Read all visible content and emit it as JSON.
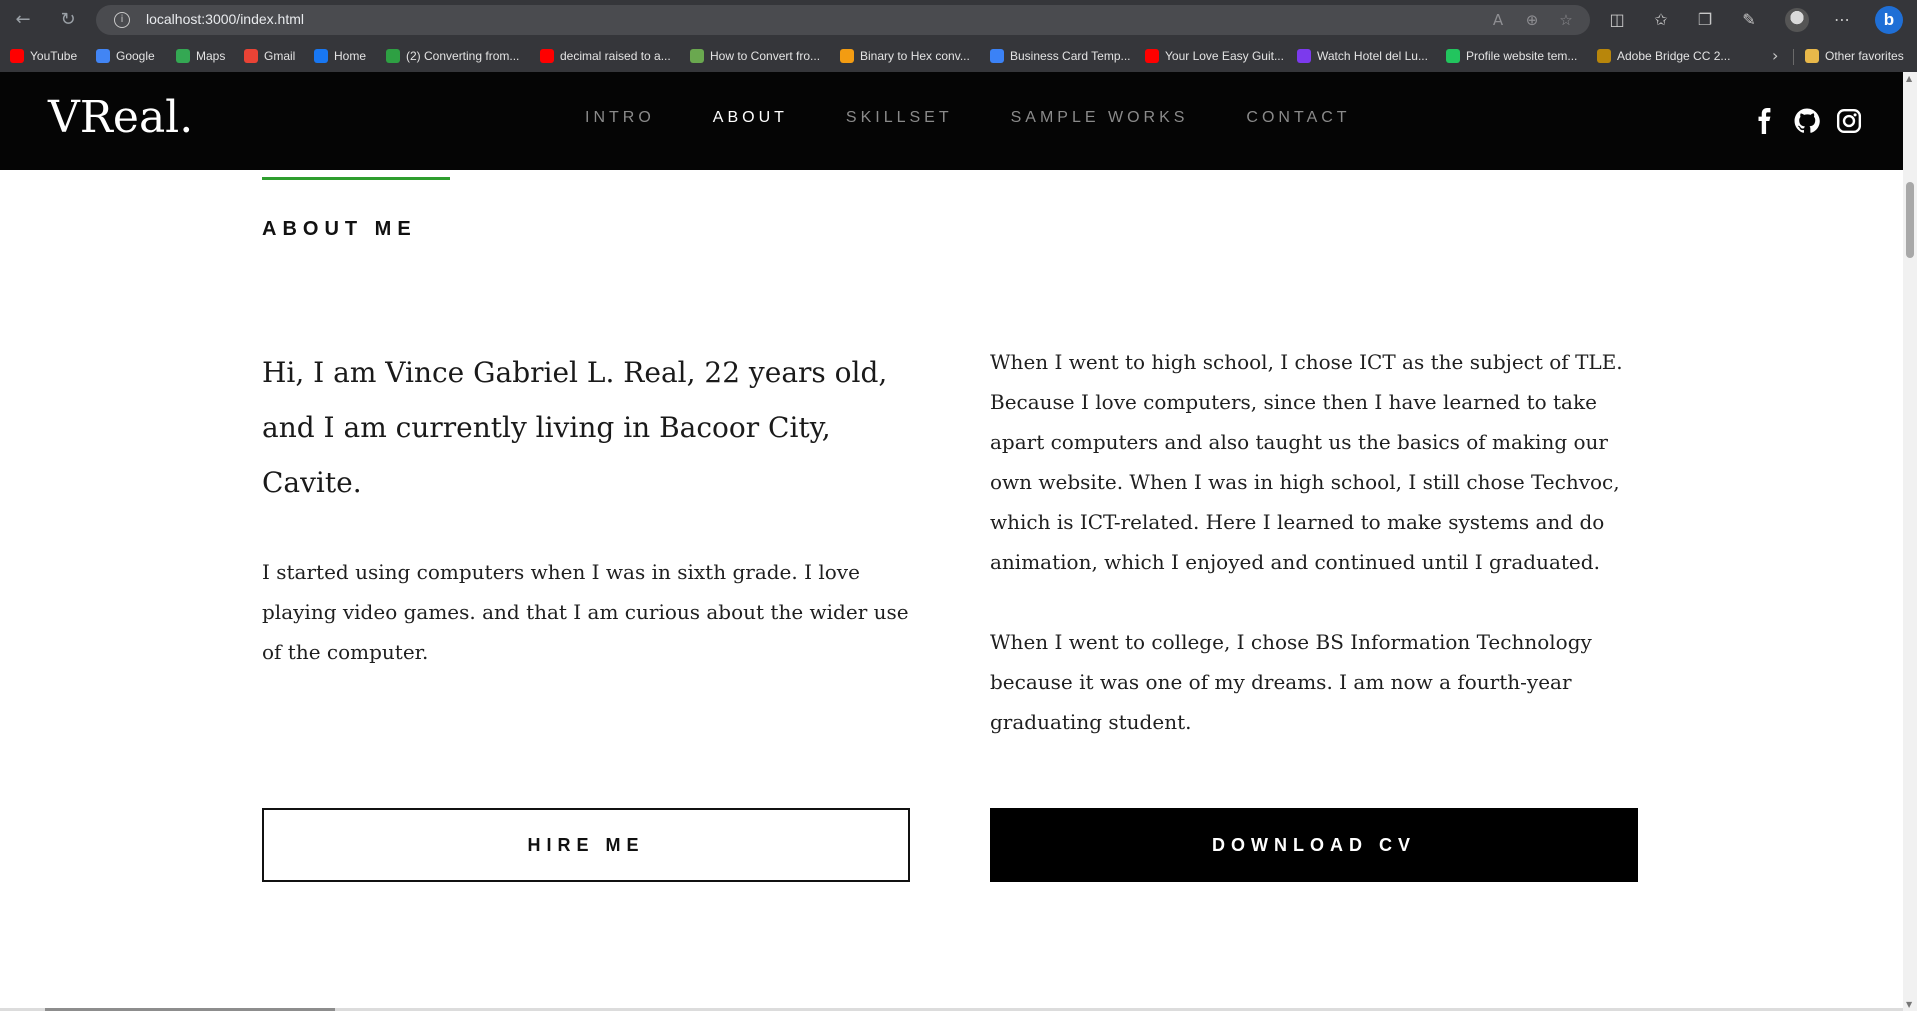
{
  "browser": {
    "url_host": "localhost",
    "url_path": ":3000/index.html",
    "bookmarks": [
      {
        "label": "YouTube",
        "color": "#ff0000"
      },
      {
        "label": "Google",
        "color": "#4285f4"
      },
      {
        "label": "Maps",
        "color": "#34a853"
      },
      {
        "label": "Gmail",
        "color": "#ea4335"
      },
      {
        "label": "Home",
        "color": "#1877f2"
      },
      {
        "label": "(2) Converting from...",
        "color": "#2ea043"
      },
      {
        "label": "decimal raised to a...",
        "color": "#ff0000"
      },
      {
        "label": "How to Convert fro...",
        "color": "#6aa84f"
      },
      {
        "label": "Binary to Hex conv...",
        "color": "#f39c12"
      },
      {
        "label": "Business Card Temp...",
        "color": "#3b82f6"
      },
      {
        "label": "Your Love Easy Guit...",
        "color": "#ff0000"
      },
      {
        "label": "Watch Hotel del Lu...",
        "color": "#7c3aed"
      },
      {
        "label": "Profile website tem...",
        "color": "#22c55e"
      },
      {
        "label": "Adobe Bridge CC 2...",
        "color": "#b8860b"
      }
    ],
    "other_favorites": "Other favorites"
  },
  "site": {
    "logo": "VReal.",
    "nav": [
      {
        "label": "INTRO",
        "active": false
      },
      {
        "label": "ABOUT",
        "active": true
      },
      {
        "label": "SKILLSET",
        "active": false
      },
      {
        "label": "SAMPLE WORKS",
        "active": false
      },
      {
        "label": "CONTACT",
        "active": false
      }
    ],
    "social_icons": [
      "facebook-icon",
      "github-icon",
      "instagram-icon"
    ]
  },
  "about": {
    "title": "ABOUT ME",
    "intro": "Hi, I am Vince Gabriel L. Real, 22 years old, and I am currently living in Bacoor City, Cavite.",
    "left_paragraph": "I started using computers when I was in sixth grade. I love playing video games. and that I am curious about the wider use of the computer.",
    "right_paragraph_1": "When I went to high school, I chose ICT as the subject of TLE. Because I love computers, since then I have learned to take apart computers and also taught us the basics of making our own website. When I was in high school, I still chose Techvoc, which is ICT-related. Here I learned to make systems and do animation, which I enjoyed and continued until I graduated.",
    "right_paragraph_2": "When I went to college, I chose BS Information Technology because it was one of my dreams. I am now a fourth-year graduating student.",
    "hire_button": "HIRE ME",
    "cv_button": "DOWNLOAD CV",
    "accent_color": "#2f9e2f"
  }
}
